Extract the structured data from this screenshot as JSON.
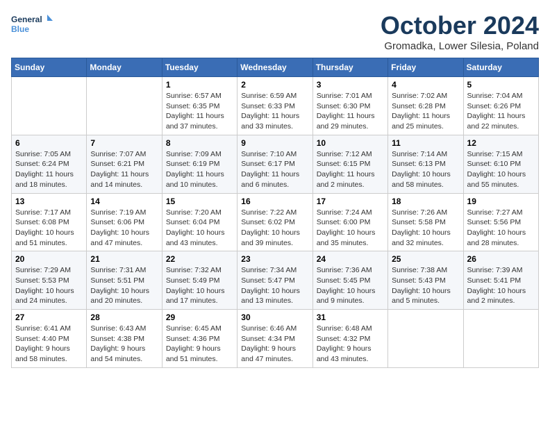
{
  "logo": {
    "line1": "General",
    "line2": "Blue"
  },
  "title": "October 2024",
  "subtitle": "Gromadka, Lower Silesia, Poland",
  "days_of_week": [
    "Sunday",
    "Monday",
    "Tuesday",
    "Wednesday",
    "Thursday",
    "Friday",
    "Saturday"
  ],
  "weeks": [
    [
      {
        "day": "",
        "info": ""
      },
      {
        "day": "",
        "info": ""
      },
      {
        "day": "1",
        "sunrise": "6:57 AM",
        "sunset": "6:35 PM",
        "daylight": "11 hours and 37 minutes."
      },
      {
        "day": "2",
        "sunrise": "6:59 AM",
        "sunset": "6:33 PM",
        "daylight": "11 hours and 33 minutes."
      },
      {
        "day": "3",
        "sunrise": "7:01 AM",
        "sunset": "6:30 PM",
        "daylight": "11 hours and 29 minutes."
      },
      {
        "day": "4",
        "sunrise": "7:02 AM",
        "sunset": "6:28 PM",
        "daylight": "11 hours and 25 minutes."
      },
      {
        "day": "5",
        "sunrise": "7:04 AM",
        "sunset": "6:26 PM",
        "daylight": "11 hours and 22 minutes."
      }
    ],
    [
      {
        "day": "6",
        "sunrise": "7:05 AM",
        "sunset": "6:24 PM",
        "daylight": "11 hours and 18 minutes."
      },
      {
        "day": "7",
        "sunrise": "7:07 AM",
        "sunset": "6:21 PM",
        "daylight": "11 hours and 14 minutes."
      },
      {
        "day": "8",
        "sunrise": "7:09 AM",
        "sunset": "6:19 PM",
        "daylight": "11 hours and 10 minutes."
      },
      {
        "day": "9",
        "sunrise": "7:10 AM",
        "sunset": "6:17 PM",
        "daylight": "11 hours and 6 minutes."
      },
      {
        "day": "10",
        "sunrise": "7:12 AM",
        "sunset": "6:15 PM",
        "daylight": "11 hours and 2 minutes."
      },
      {
        "day": "11",
        "sunrise": "7:14 AM",
        "sunset": "6:13 PM",
        "daylight": "10 hours and 58 minutes."
      },
      {
        "day": "12",
        "sunrise": "7:15 AM",
        "sunset": "6:10 PM",
        "daylight": "10 hours and 55 minutes."
      }
    ],
    [
      {
        "day": "13",
        "sunrise": "7:17 AM",
        "sunset": "6:08 PM",
        "daylight": "10 hours and 51 minutes."
      },
      {
        "day": "14",
        "sunrise": "7:19 AM",
        "sunset": "6:06 PM",
        "daylight": "10 hours and 47 minutes."
      },
      {
        "day": "15",
        "sunrise": "7:20 AM",
        "sunset": "6:04 PM",
        "daylight": "10 hours and 43 minutes."
      },
      {
        "day": "16",
        "sunrise": "7:22 AM",
        "sunset": "6:02 PM",
        "daylight": "10 hours and 39 minutes."
      },
      {
        "day": "17",
        "sunrise": "7:24 AM",
        "sunset": "6:00 PM",
        "daylight": "10 hours and 35 minutes."
      },
      {
        "day": "18",
        "sunrise": "7:26 AM",
        "sunset": "5:58 PM",
        "daylight": "10 hours and 32 minutes."
      },
      {
        "day": "19",
        "sunrise": "7:27 AM",
        "sunset": "5:56 PM",
        "daylight": "10 hours and 28 minutes."
      }
    ],
    [
      {
        "day": "20",
        "sunrise": "7:29 AM",
        "sunset": "5:53 PM",
        "daylight": "10 hours and 24 minutes."
      },
      {
        "day": "21",
        "sunrise": "7:31 AM",
        "sunset": "5:51 PM",
        "daylight": "10 hours and 20 minutes."
      },
      {
        "day": "22",
        "sunrise": "7:32 AM",
        "sunset": "5:49 PM",
        "daylight": "10 hours and 17 minutes."
      },
      {
        "day": "23",
        "sunrise": "7:34 AM",
        "sunset": "5:47 PM",
        "daylight": "10 hours and 13 minutes."
      },
      {
        "day": "24",
        "sunrise": "7:36 AM",
        "sunset": "5:45 PM",
        "daylight": "10 hours and 9 minutes."
      },
      {
        "day": "25",
        "sunrise": "7:38 AM",
        "sunset": "5:43 PM",
        "daylight": "10 hours and 5 minutes."
      },
      {
        "day": "26",
        "sunrise": "7:39 AM",
        "sunset": "5:41 PM",
        "daylight": "10 hours and 2 minutes."
      }
    ],
    [
      {
        "day": "27",
        "sunrise": "6:41 AM",
        "sunset": "4:40 PM",
        "daylight": "9 hours and 58 minutes."
      },
      {
        "day": "28",
        "sunrise": "6:43 AM",
        "sunset": "4:38 PM",
        "daylight": "9 hours and 54 minutes."
      },
      {
        "day": "29",
        "sunrise": "6:45 AM",
        "sunset": "4:36 PM",
        "daylight": "9 hours and 51 minutes."
      },
      {
        "day": "30",
        "sunrise": "6:46 AM",
        "sunset": "4:34 PM",
        "daylight": "9 hours and 47 minutes."
      },
      {
        "day": "31",
        "sunrise": "6:48 AM",
        "sunset": "4:32 PM",
        "daylight": "9 hours and 43 minutes."
      },
      {
        "day": "",
        "info": ""
      },
      {
        "day": "",
        "info": ""
      }
    ]
  ]
}
